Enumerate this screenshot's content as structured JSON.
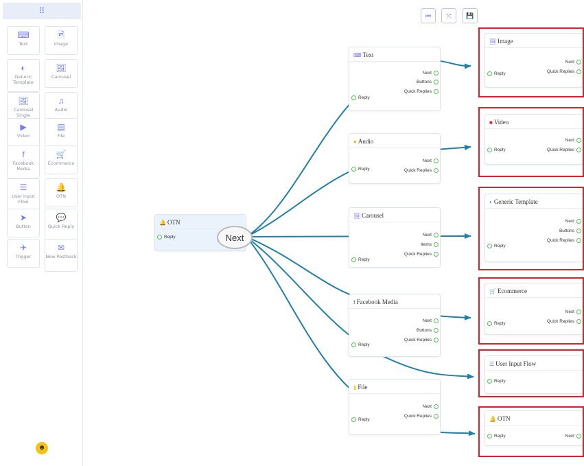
{
  "sidebar": {
    "header_icon": "grid-icon",
    "tiles": [
      {
        "label": "Text",
        "icon": "⌨",
        "icon_name": "keyboard-icon"
      },
      {
        "label": "Image",
        "icon": "🖻",
        "icon_name": "image-file-icon"
      },
      {
        "label": "Generic Template",
        "icon": "◐",
        "icon_name": "half-circle-icon"
      },
      {
        "label": "Carousel",
        "icon": "🖼",
        "icon_name": "images-icon"
      },
      {
        "label": "Carousel Single",
        "icon": "🖼",
        "icon_name": "image-icon"
      },
      {
        "label": "Audio",
        "icon": "♫",
        "icon_name": "audio-file-icon"
      },
      {
        "label": "Video",
        "icon": "▶",
        "icon_name": "video-file-icon"
      },
      {
        "label": "File",
        "icon": "▤",
        "icon_name": "file-icon"
      },
      {
        "label": "Facebook Media",
        "icon": "f",
        "icon_name": "facebook-icon"
      },
      {
        "label": "Ecommerce",
        "icon": "🛒",
        "icon_name": "cart-icon"
      },
      {
        "label": "User Input Flow",
        "icon": "☰",
        "icon_name": "list-lines-icon"
      },
      {
        "label": "OTN",
        "icon": "🔔",
        "icon_name": "bell-icon"
      },
      {
        "label": "Button",
        "icon": "➤",
        "icon_name": "paper-plane-icon"
      },
      {
        "label": "Quick Reply",
        "icon": "💬",
        "icon_name": "chat-bubble-icon"
      },
      {
        "label": "Trigger",
        "icon": "✈",
        "icon_name": "plane-takeoff-icon"
      },
      {
        "label": "New Postback",
        "icon": "✉",
        "icon_name": "envelope-icon"
      }
    ],
    "bottom_icon": "bot-avatar-icon"
  },
  "toolbar": {
    "buttons": [
      {
        "icon": "⏮",
        "name": "first-page-icon"
      },
      {
        "icon": "⤧",
        "name": "fit-view-icon"
      },
      {
        "icon": "💾",
        "name": "save-icon"
      }
    ]
  },
  "source_node": {
    "title": "OTN",
    "icon": "🔔",
    "input": "Reply",
    "next_badge": "Next"
  },
  "middle_nodes": [
    {
      "title": "Text",
      "icon": "⌨",
      "icon_color": "#6f7cf0",
      "outputs": [
        "Next",
        "Buttons",
        "Quick Replies"
      ],
      "input": "Reply"
    },
    {
      "title": "Audio",
      "icon": "●",
      "icon_color": "#f2b01b",
      "outputs": [
        "Next",
        "Quick Replies"
      ],
      "input": "Reply"
    },
    {
      "title": "Carousel",
      "icon": "🖼",
      "icon_color": "#6f7cf0",
      "outputs": [
        "Next",
        "Items",
        "Quick Replies"
      ],
      "input": "Reply"
    },
    {
      "title": "Facebook Media",
      "icon": "f",
      "icon_color": "#3b5998",
      "outputs": [
        "Next",
        "Buttons",
        "Quick Replies"
      ],
      "input": "Reply"
    },
    {
      "title": "File",
      "icon": "▮",
      "icon_color": "#f2d14b",
      "outputs": [
        "Next",
        "Quick Replies"
      ],
      "input": "Reply"
    }
  ],
  "right_nodes": [
    {
      "title": "Image",
      "icon": "🖼",
      "icon_color": "#6f7cf0",
      "outputs": [
        "Next",
        "Quick Replies"
      ],
      "input": "Reply"
    },
    {
      "title": "Video",
      "icon": "■",
      "icon_color": "#e11d2a",
      "outputs": [
        "Next",
        "Quick Replies"
      ],
      "input": "Reply"
    },
    {
      "title": "Generic Template",
      "icon": "◐",
      "icon_color": "#6f7cf0",
      "outputs": [
        "Next",
        "Buttons",
        "Quick Replies"
      ],
      "input": "Reply"
    },
    {
      "title": "Ecommerce",
      "icon": "🛒",
      "icon_color": "#6f7cf0",
      "outputs": [
        "Next",
        "Quick Replies"
      ],
      "input": "Reply"
    },
    {
      "title": "User Input Flow",
      "icon": "☰",
      "icon_color": "#6f7cf0",
      "outputs": [],
      "input": "Reply"
    },
    {
      "title": "OTN",
      "icon": "🔔",
      "icon_color": "#222222",
      "outputs": [
        "Next"
      ],
      "input": "Reply"
    }
  ],
  "colors": {
    "edge": "#1f7fa6",
    "highlight": "#e11d2a",
    "accent": "#6f7cf0",
    "port": "#53c153"
  }
}
